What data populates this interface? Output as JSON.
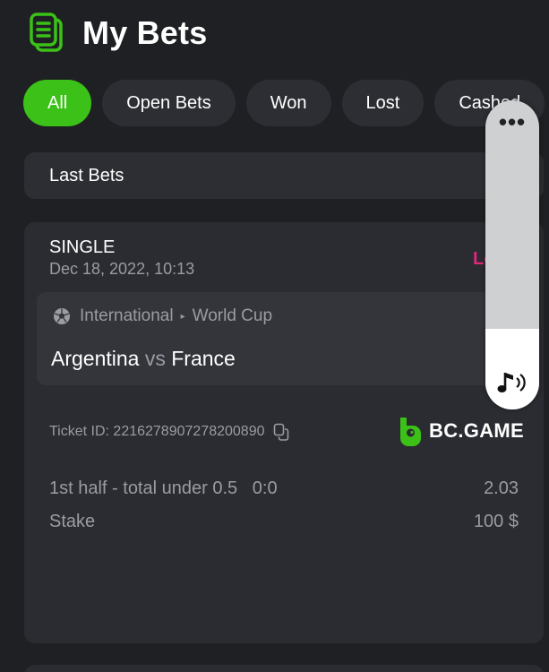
{
  "header": {
    "title": "My Bets",
    "icon": "bets-list-icon",
    "accent_color": "#3bc117"
  },
  "tabs": [
    {
      "label": "All",
      "active": true
    },
    {
      "label": "Open Bets",
      "active": false
    },
    {
      "label": "Won",
      "active": false
    },
    {
      "label": "Lost",
      "active": false
    },
    {
      "label": "Cashed",
      "active": false
    }
  ],
  "filter": {
    "label": "Last Bets"
  },
  "bet": {
    "type": "SINGLE",
    "date": "Dec 18, 2022, 10:13",
    "status": "Lost",
    "status_color": "#e0267c",
    "category": "International",
    "tournament": "World Cup",
    "team_home": "Argentina",
    "vs": "vs",
    "team_away": "France",
    "ticket_label": "Ticket ID: 2216278907278200890",
    "brand": "BC.GAME",
    "selection": "1st half - total under 0.5   0:0",
    "odds": "2.03",
    "stake_label": "Stake",
    "stake_value": "100 $"
  },
  "volume_overlay": {
    "more_label": "•••",
    "level": 0.26
  }
}
